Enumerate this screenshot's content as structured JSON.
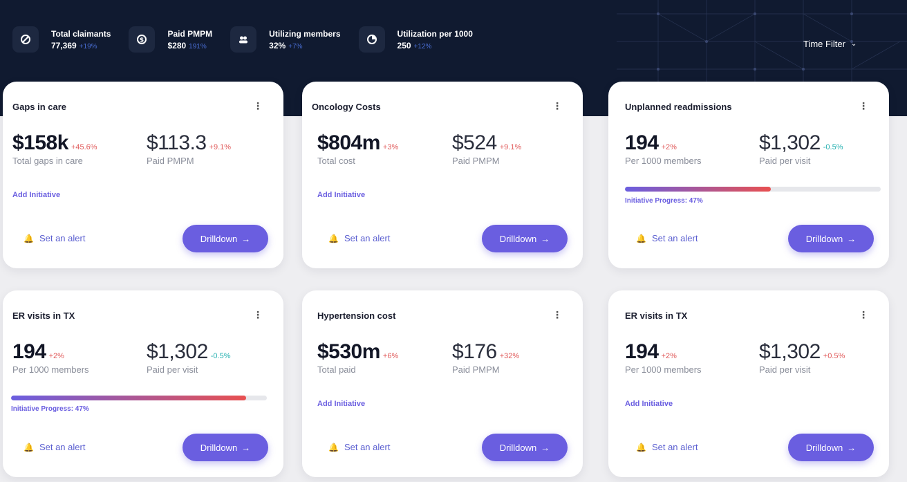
{
  "header": {
    "stats": [
      {
        "icon": "claimants-icon",
        "label": "Total claimants",
        "value": "77,369",
        "change": "+19%"
      },
      {
        "icon": "dollar-icon",
        "label": "Paid PMPM",
        "value": "$280",
        "change": "191%"
      },
      {
        "icon": "members-icon",
        "label": "Utilizing members",
        "value": "32%",
        "change": "+7%"
      },
      {
        "icon": "utilization-icon",
        "label": "Utilization per 1000",
        "value": "250",
        "change": "+12%"
      }
    ],
    "time_filter": "Time Filter"
  },
  "cards": [
    {
      "title": "Gaps in care",
      "primary": {
        "value": "$158k",
        "change": "+45.6%",
        "label": "Total gaps in care"
      },
      "secondary": {
        "value": "$113.3",
        "change": "+9.1%",
        "label": "Paid PMPM"
      },
      "add_initiative": "Add Initiative",
      "alert": "Set an alert",
      "drilldown": "Drilldown"
    },
    {
      "title": "Oncology Costs",
      "primary": {
        "value": "$804m",
        "change": "+3%",
        "label": "Total cost"
      },
      "secondary": {
        "value": "$524",
        "change": "+9.1%",
        "label": "Paid PMPM"
      },
      "add_initiative": "Add Initiative",
      "alert": "Set an alert",
      "drilldown": "Drilldown"
    },
    {
      "title": "Unplanned readmissions",
      "primary": {
        "value": "194",
        "change": "+2%",
        "label": "Per 1000 members"
      },
      "secondary": {
        "value": "$1,302",
        "change": "-0.5%",
        "label": "Paid per visit"
      },
      "progress_label": "Initiative Progress: 47%",
      "progress_value": 0.57,
      "alert": "Set an alert",
      "drilldown": "Drilldown"
    },
    {
      "title": "ER visits in TX",
      "primary": {
        "value": "194",
        "change": "+2%",
        "label": "Per 1000 members"
      },
      "secondary": {
        "value": "$1,302",
        "change": "-0.5%",
        "label": "Paid per visit"
      },
      "progress_label": "Initiative Progress: 47%",
      "progress_value": 0.92,
      "alert": "Set an alert",
      "drilldown": "Drilldown"
    },
    {
      "title": "Hypertension cost",
      "primary": {
        "value": "$530m",
        "change": "+6%",
        "label": "Total paid"
      },
      "secondary": {
        "value": "$176",
        "change": "+32%",
        "label": "Paid PMPM"
      },
      "add_initiative": "Add Initiative",
      "alert": "Set an alert",
      "drilldown": "Drilldown"
    },
    {
      "title": "ER visits in TX",
      "primary": {
        "value": "194",
        "change": "+2%",
        "label": "Per 1000 members"
      },
      "secondary": {
        "value": "$1,302",
        "change": "+0.5%",
        "label": "Paid per visit"
      },
      "add_initiative": "Add Initiative",
      "alert": "Set an alert",
      "drilldown": "Drilldown"
    }
  ],
  "colors": {
    "header_bg": "#101a30",
    "accent": "#6a5ee0",
    "negative": "#e05a5a",
    "positive": "#24b0b0"
  }
}
